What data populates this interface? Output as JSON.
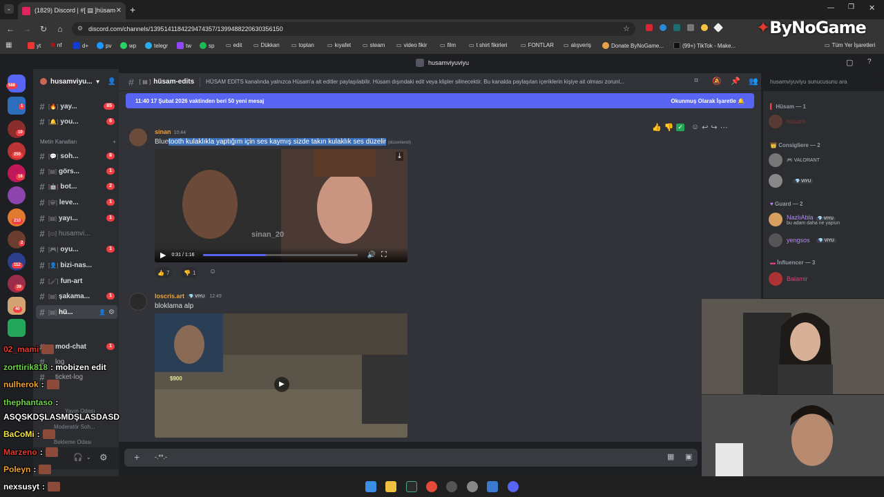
{
  "browser": {
    "tab_title": "(1829) Discord | #[ ▤ ]hüsam-e",
    "url": "discord.com/channels/1395141184229474357/1399488220630356150",
    "bookmarks": [
      "yt",
      "nf",
      "d+",
      "pv",
      "wp",
      "telegr",
      "tw",
      "sp",
      "edit",
      "Dükkan",
      "toptan",
      "kıyafet",
      "steam",
      "video fikir",
      "film",
      "t shirt fikirleri",
      "FONTLAR",
      "alışveriş",
      "Donate ByNoGame...",
      "(99+) TikTok - Make...",
      "Tüm Yer İşaretleri"
    ]
  },
  "watermark": "ByNoGame",
  "discord": {
    "top_title": "husamviyuviyu",
    "server_name": "husamviyu...",
    "server_badges": [
      "588",
      "1",
      "10",
      "255",
      "16",
      "210",
      "2",
      "112",
      "39",
      "40"
    ],
    "channels": [
      {
        "name": "yay...",
        "count": "85"
      },
      {
        "name": "you...",
        "count": "6"
      },
      {
        "name": "soh...",
        "count": "8"
      },
      {
        "name": "görs...",
        "count": "1"
      },
      {
        "name": "bot...",
        "count": "2"
      },
      {
        "name": "leve...",
        "count": "1"
      },
      {
        "name": "yayı...",
        "count": "1"
      },
      {
        "name": "husamvi...",
        "count": ""
      },
      {
        "name": "oyu...",
        "count": "1"
      },
      {
        "name": "bizi-nas...",
        "count": ""
      },
      {
        "name": "fun-art",
        "count": ""
      },
      {
        "name": "şakama...",
        "count": "1"
      },
      {
        "name": "hü...",
        "count": ""
      },
      {
        "name": "mod-chat",
        "count": "1"
      },
      {
        "name": "log",
        "count": ""
      },
      {
        "name": "ticket-log",
        "count": ""
      }
    ],
    "category_text": "Metin Kanalları",
    "voice": [
      "Yayın Odası",
      "Moderatör Soh...",
      "Bekleme Odası"
    ],
    "channel_header": {
      "name": "hüsam-edits",
      "topic": "HÜSAM EDİTS kanalında yalnızca Hüsam'a ait editler paylaşılabilir. Hüsam dışındaki edit veya klipler silinecektir. Bu kanalda paylaşılan içeriklerin kişiye ait olması zorunl...",
      "search_placeholder": "husamviyuviyu sunucusunu ara"
    },
    "new_messages_bar": {
      "text": "11:40 17 Şubat 2026 vaktinden beri 50 yeni mesaj",
      "action": "Okunmuş Olarak İşaretle"
    },
    "messages": [
      {
        "author": "sinan",
        "time": "10:44",
        "text_plain": "Blue",
        "text_selected": "tooth kulaklıkla yaptığım için ses kaymış sizde takın kulaklık ses düzelir",
        "edited": "(düzenlendi)",
        "video": {
          "time": "0:31 / 1:16",
          "watermark": "sinan_20",
          "progress": 0.41
        },
        "reactions": [
          {
            "emoji": "👍",
            "count": "7"
          },
          {
            "emoji": "👎",
            "count": "1"
          }
        ]
      },
      {
        "author": "loscris.art",
        "tag": "VIYU",
        "time": "12:49",
        "text": "bloklama alp",
        "video": {
          "money": "$900"
        }
      }
    ],
    "composer_text": "-.**.-",
    "members": {
      "groups": [
        {
          "title": "Hüsam — 1",
          "items": [
            {
              "name": "hüsam",
              "sub": ""
            }
          ]
        },
        {
          "title": "Consigliere — 2",
          "items": [
            {
              "name": "",
              "sub": "VALORANT"
            },
            {
              "name": "",
              "sub": "",
              "tag": "VIYU"
            }
          ]
        },
        {
          "title": "Guard — 2",
          "items": [
            {
              "name": "NazlıAbla",
              "sub": "bu adam daha ne yapsın",
              "tag": "VIYU"
            },
            {
              "name": "yengsos",
              "sub": "",
              "tag": "VIYU"
            }
          ]
        },
        {
          "title": "İnfluencer — 3",
          "items": [
            {
              "name": "Balamir",
              "sub": ""
            }
          ]
        }
      ]
    }
  },
  "stream_chat": [
    {
      "user": "02_mami",
      "msg": ""
    },
    {
      "user": "zorttirik818",
      "msg": ": mobizen edit"
    },
    {
      "user": "nulherok",
      "msg": ":"
    },
    {
      "user": "thephantaso",
      "msg": ":"
    },
    {
      "user": "",
      "msg": "ASQSKDŞLASMDŞLASDASD"
    },
    {
      "user": "BaCoMi",
      "msg": ":"
    },
    {
      "user": "Marzeno",
      "msg": ":"
    },
    {
      "user": "Poleyn",
      "msg": ":"
    },
    {
      "user": "nexsusyt",
      "msg": ":"
    }
  ],
  "colors": {
    "blurple": "#5865f2",
    "bg_main": "#313338",
    "bg_side": "#2b2d31",
    "red_badge": "#f23f43",
    "author_orange": "#f0a232",
    "link_blue": "#00a8fc"
  }
}
